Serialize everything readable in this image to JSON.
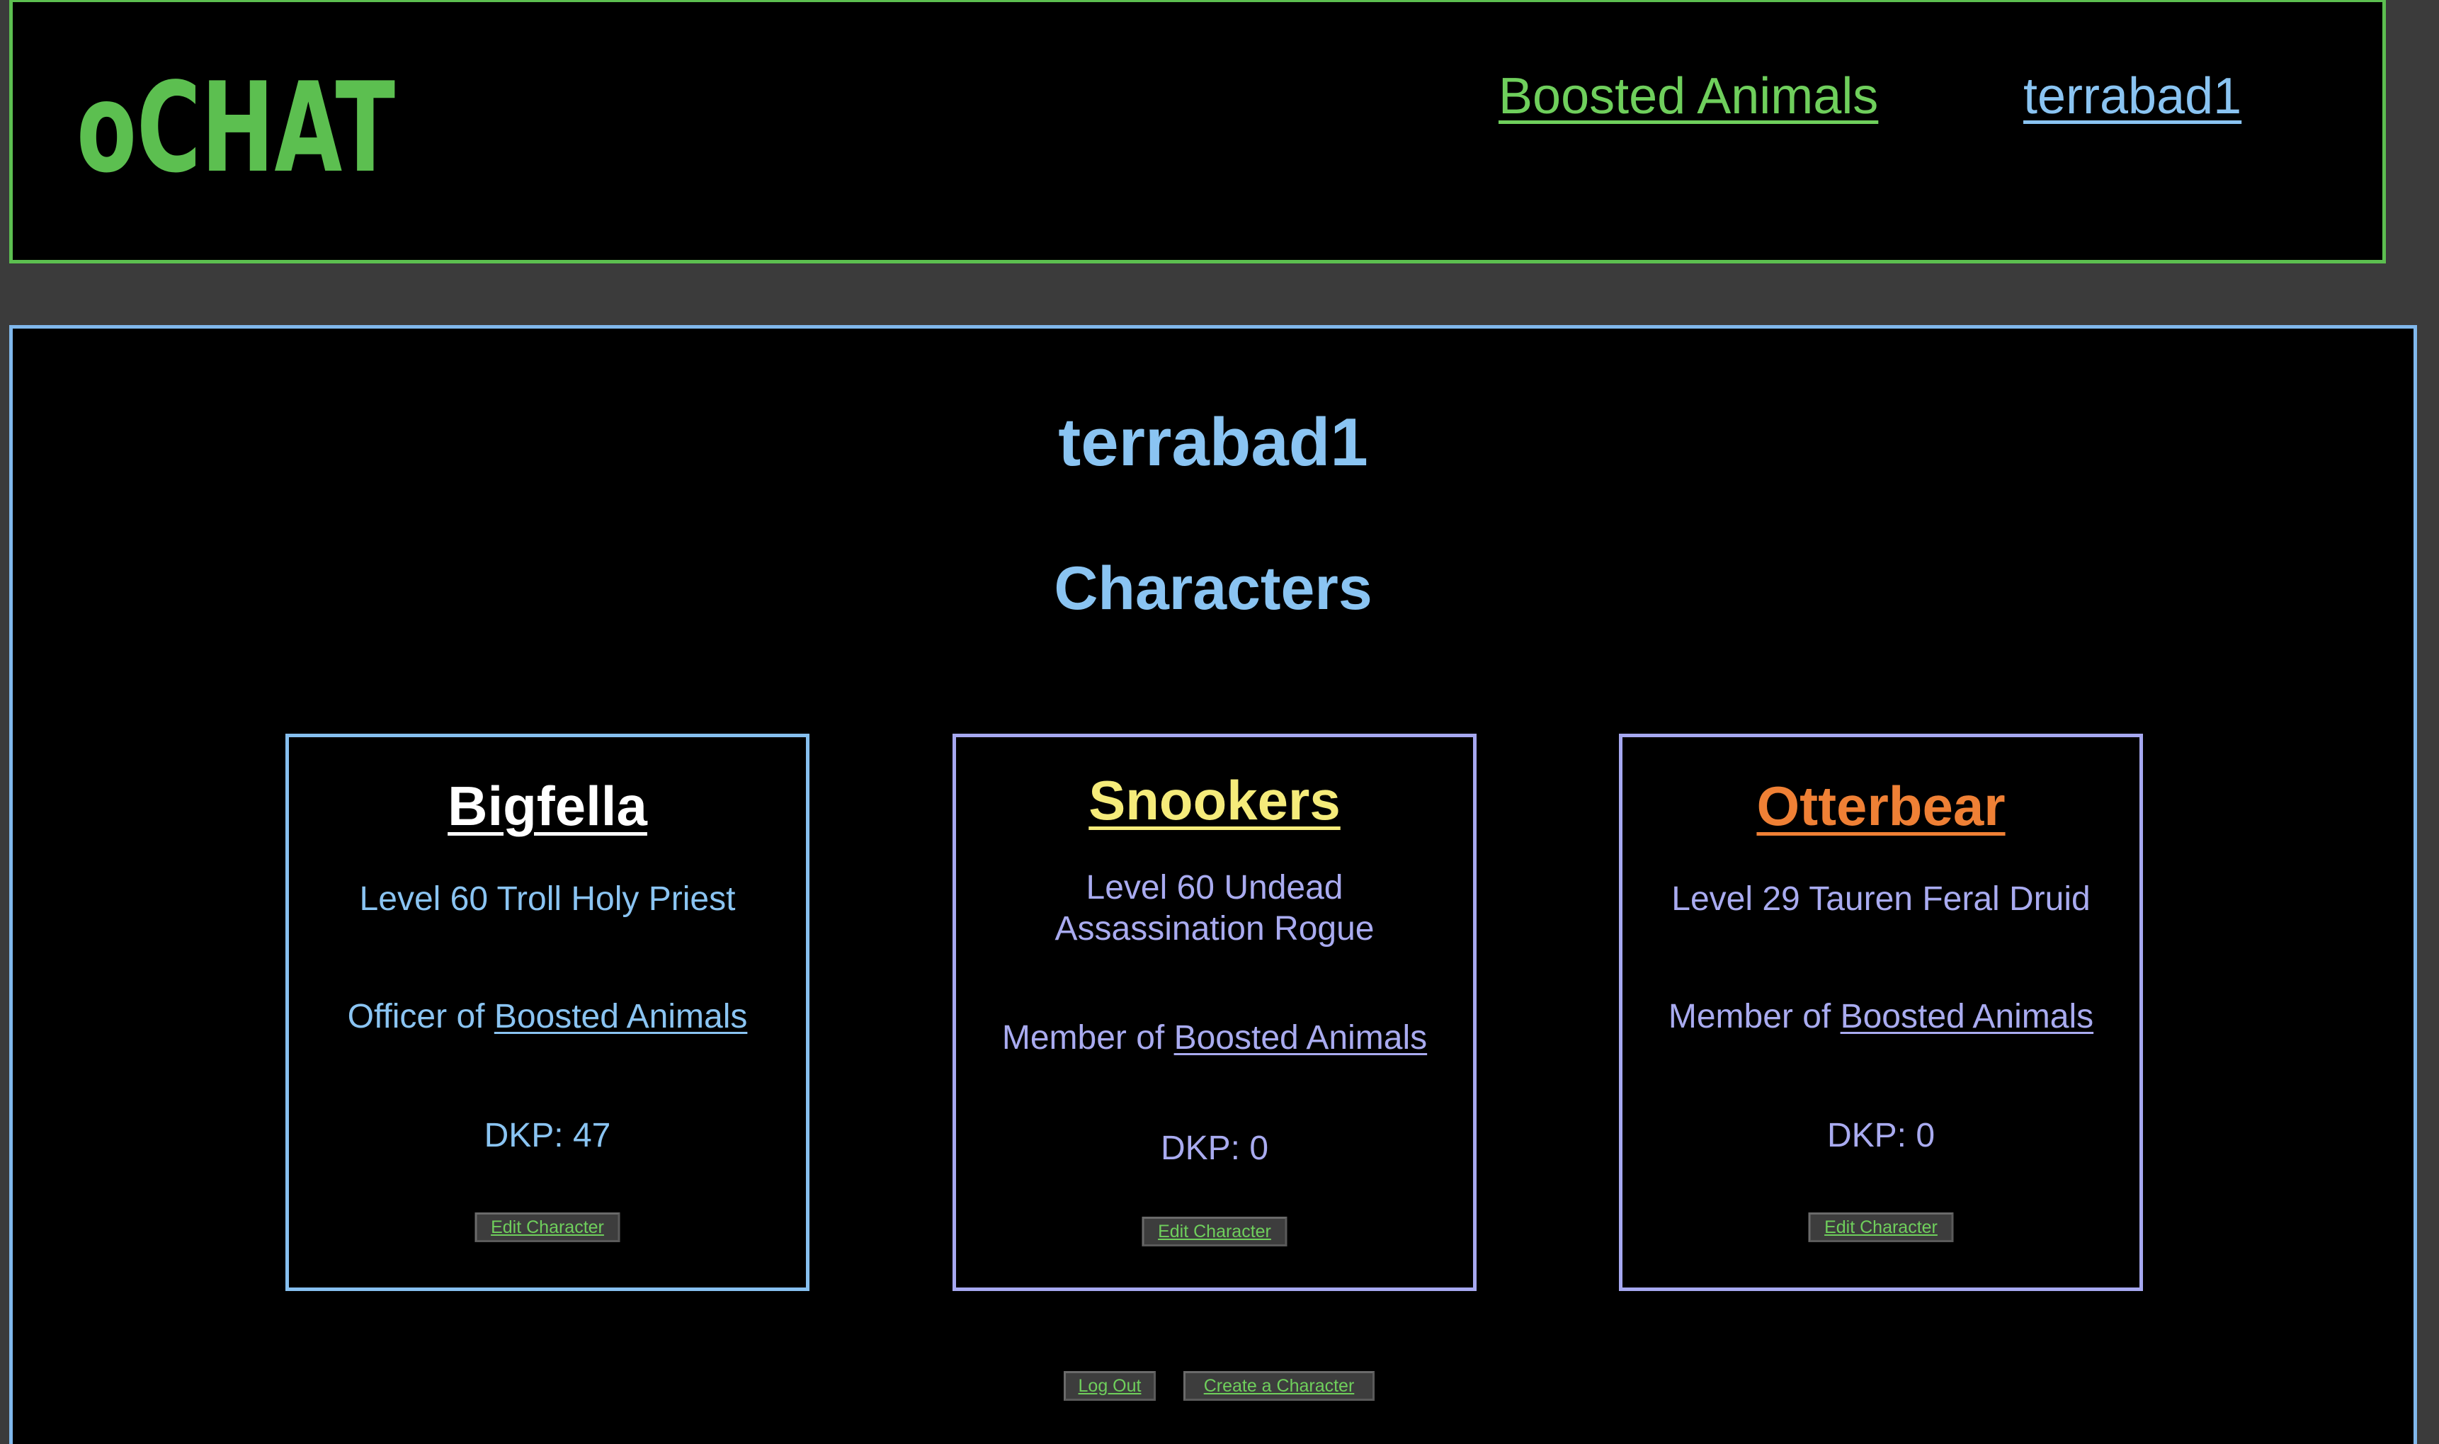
{
  "header": {
    "logo_text": "oCHAT",
    "guild_link": "Boosted Animals",
    "user_link": "terrabad1"
  },
  "profile": {
    "username": "terrabad1",
    "section_title": "Characters"
  },
  "characters": [
    {
      "name": "Bigfella",
      "name_color": "#ffffff",
      "description": "Level 60 Troll Holy Priest",
      "membership_prefix": "Officer of ",
      "guild": "Boosted Animals",
      "dkp": "DKP: 47",
      "edit_label": "Edit Character"
    },
    {
      "name": "Snookers",
      "name_color": "#f5eb7a",
      "description": "Level 60 Undead Assassination Rogue",
      "membership_prefix": "Member of ",
      "guild": "Boosted Animals",
      "dkp": "DKP: 0",
      "edit_label": "Edit Character"
    },
    {
      "name": "Otterbear",
      "name_color": "#ef8035",
      "description": "Level 29 Tauren Feral Druid",
      "membership_prefix": "Member of ",
      "guild": "Boosted Animals",
      "dkp": "DKP: 0",
      "edit_label": "Edit Character"
    }
  ],
  "actions": {
    "logout_label": "Log Out",
    "create_label": "Create a Character"
  },
  "colors": {
    "header_border": "#5cbf50",
    "main_border": "#80b8ec",
    "accent_green": "#6fcf5c",
    "accent_blue": "#8ac4f2",
    "accent_purple": "#a9abf0"
  }
}
